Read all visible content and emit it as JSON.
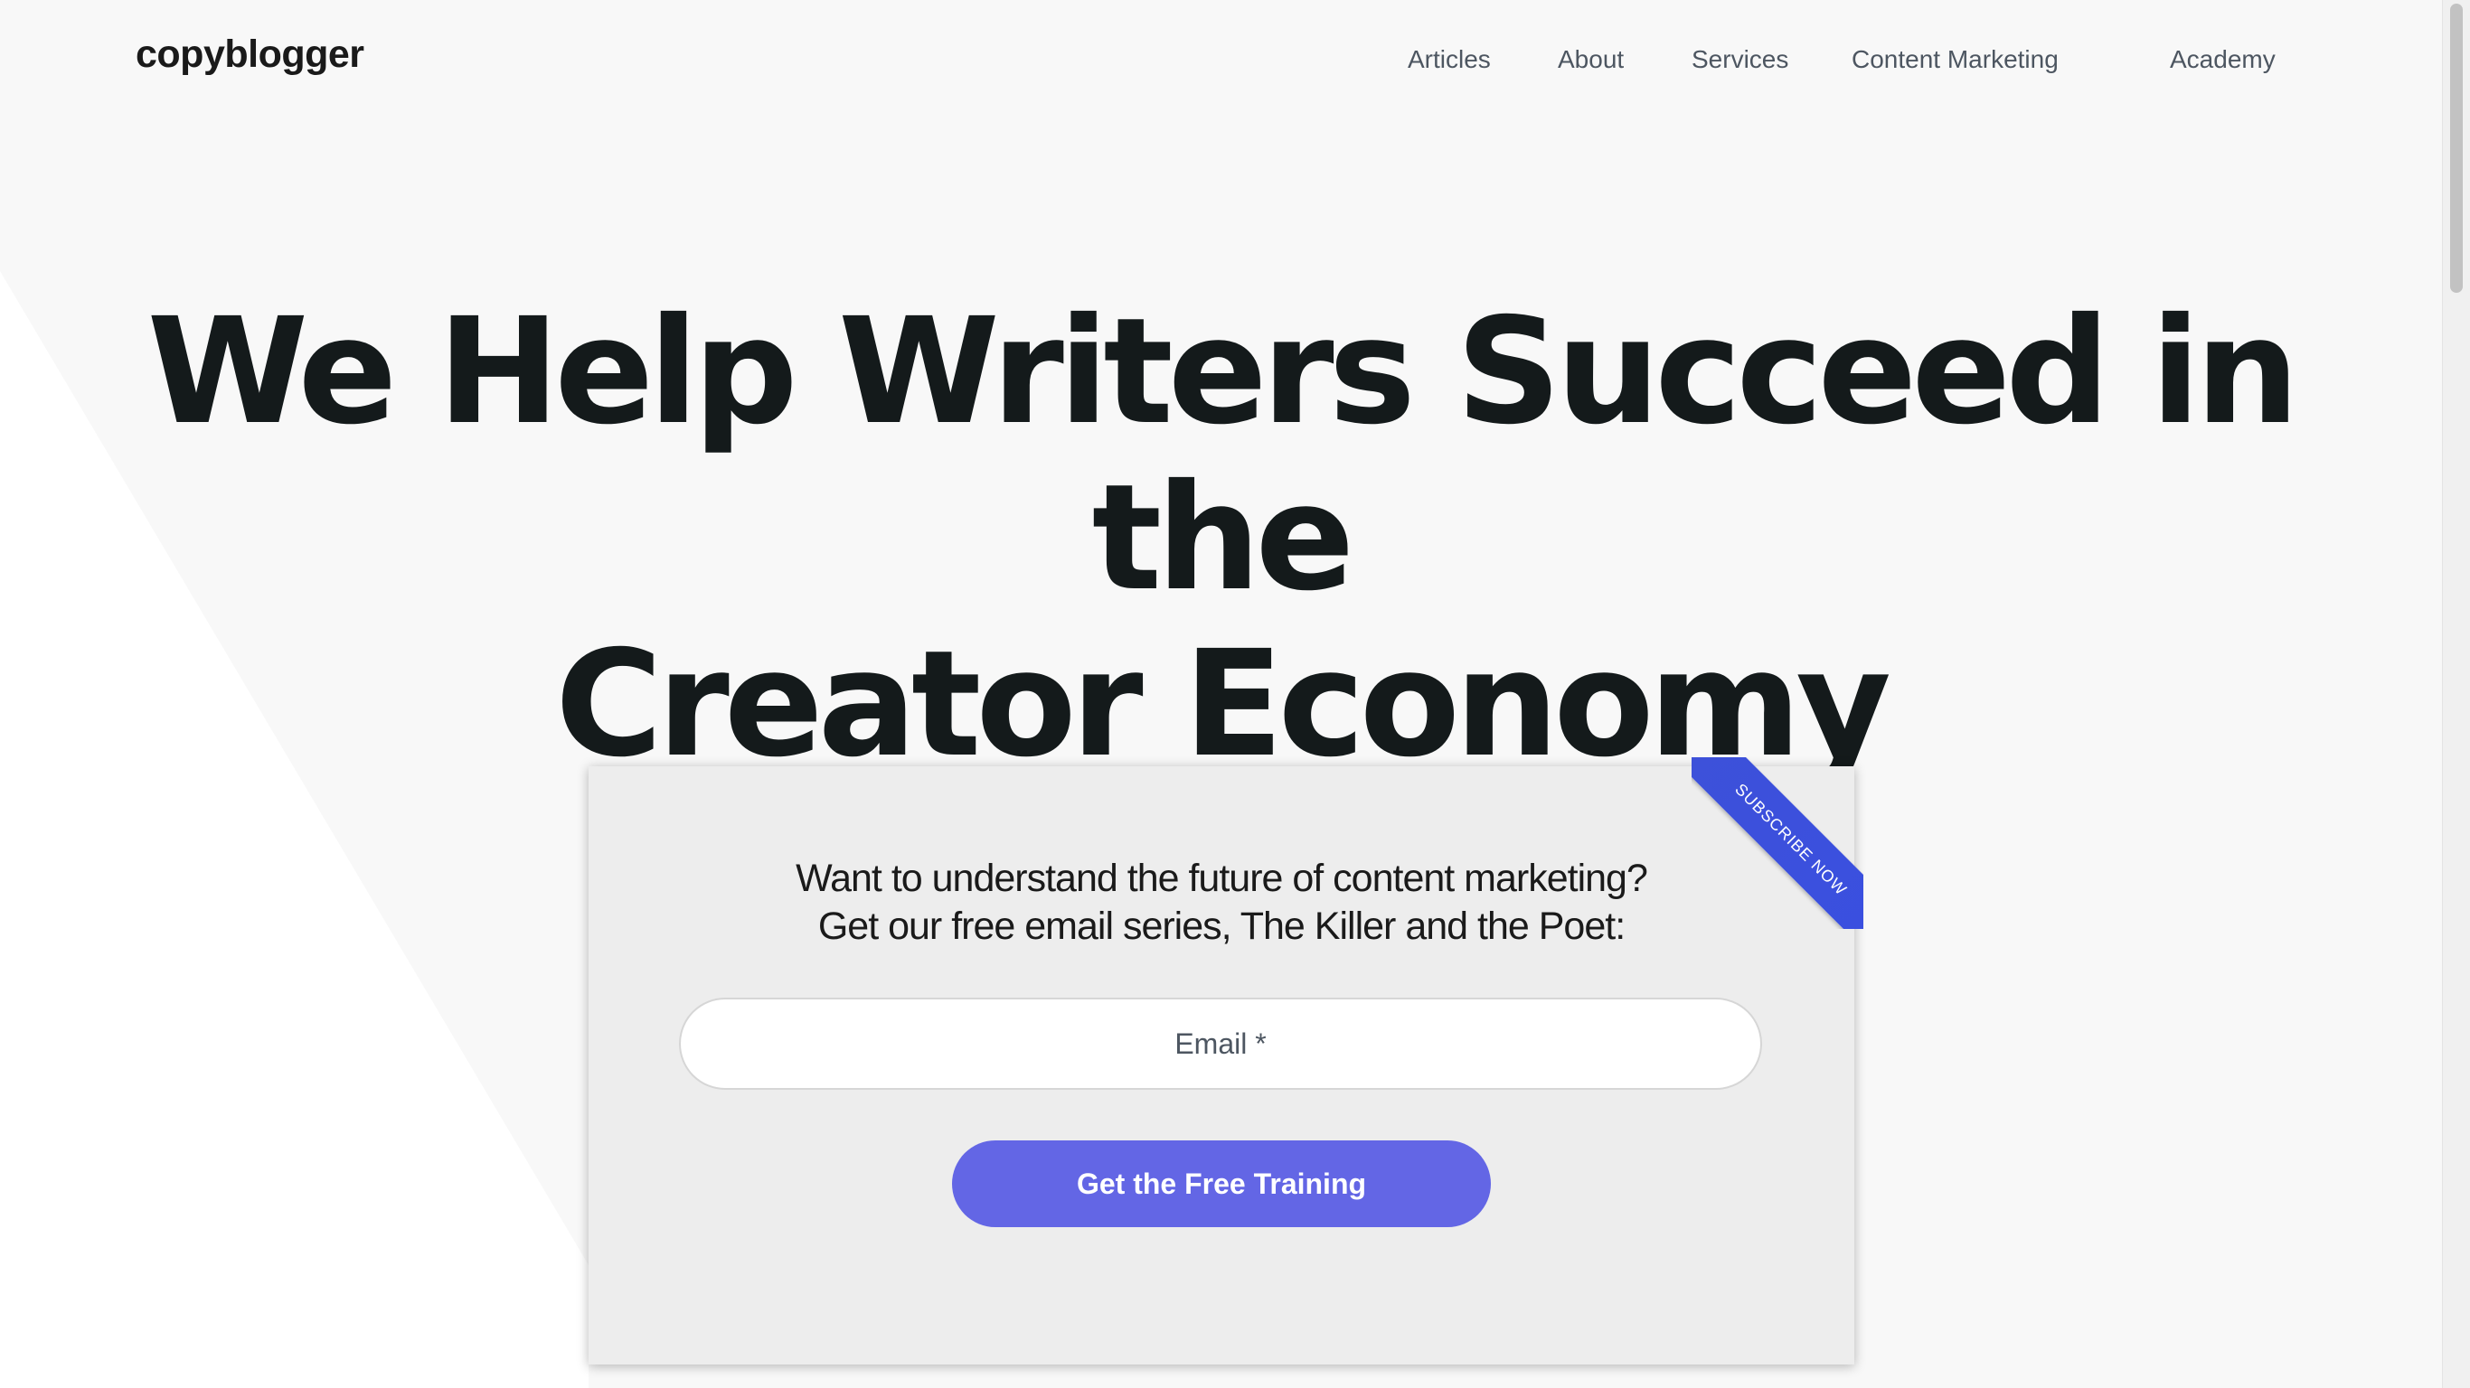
{
  "header": {
    "logo": "copyblogger",
    "nav": [
      {
        "label": "Articles"
      },
      {
        "label": "About"
      },
      {
        "label": "Services"
      },
      {
        "label": "Content Marketing"
      },
      {
        "label": "Academy"
      }
    ]
  },
  "hero": {
    "headline_line1": "We Help Writers Succeed in the",
    "headline_line2": "Creator Economy"
  },
  "signup": {
    "ribbon": "SUBSCRIBE NOW",
    "text_line1": "Want to understand the future of content marketing?",
    "text_line2": "Get our free email series, The Killer and the Poet:",
    "email_placeholder": "Email *",
    "button_label": "Get the Free Training"
  },
  "colors": {
    "accent_button": "#6366e5",
    "ribbon": "#3d51d9",
    "headline": "#141a1b",
    "nav_text": "#4d5661",
    "background": "#f8f8f8",
    "card_background": "#ededed"
  }
}
